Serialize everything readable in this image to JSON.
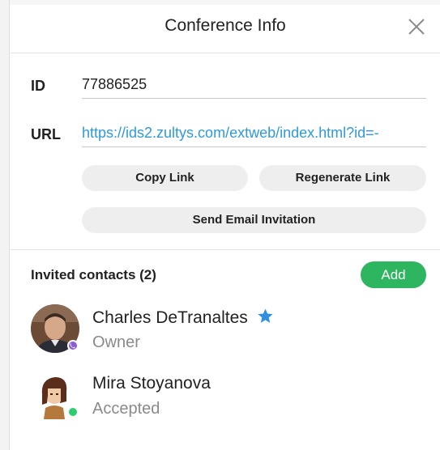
{
  "header": {
    "title": "Conference Info"
  },
  "conference": {
    "id_label": "ID",
    "id_value": "77886525",
    "url_label": "URL",
    "url_value": "https://ids2.zultys.com/extweb/index.html?id=-"
  },
  "buttons": {
    "copy_link": "Copy Link",
    "regenerate_link": "Regenerate Link",
    "send_email": "Send Email Invitation",
    "add": "Add"
  },
  "invited": {
    "title": "Invited contacts (2)",
    "contacts": [
      {
        "name": "Charles DeTranaltes",
        "role": "Owner",
        "status_color": "#8e5bd6",
        "is_owner": true
      },
      {
        "name": "Mira Stoyanova",
        "role": "Accepted",
        "status_color": "#2ecc71",
        "is_owner": false
      }
    ]
  },
  "colors": {
    "accent_link": "#2f9ad9",
    "add_button": "#2eb55f",
    "star": "#2f8fe0"
  }
}
